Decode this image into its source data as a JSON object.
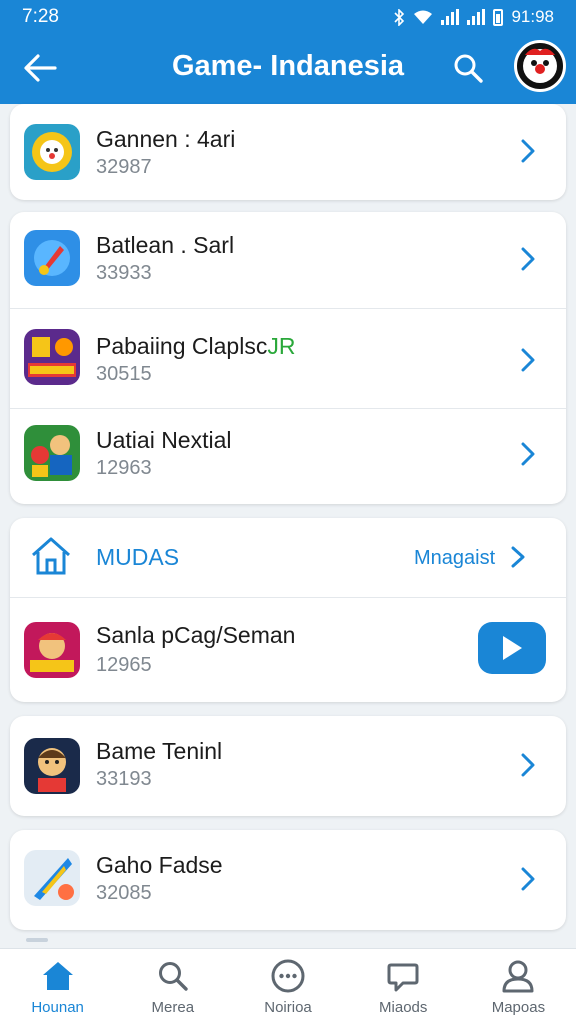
{
  "status_bar": {
    "time": "7:28",
    "right_text": "91:98"
  },
  "header": {
    "title": "Game- Indanesia",
    "back_icon": "arrow-left-icon",
    "search_icon": "search-icon",
    "avatar_icon": "clown-avatar-icon"
  },
  "brand_color": "#1a86d6",
  "cards": [
    {
      "items": [
        {
          "name": "Gannen : 4ari",
          "number": "32987",
          "icon": "sun-face-game-icon"
        }
      ]
    },
    {
      "items": [
        {
          "name": "Batlean . Sarl",
          "number": "33933",
          "icon": "rocket-game-icon"
        },
        {
          "name_main": "Pabaiing Claplsc",
          "name_accent": "JR",
          "number": "30515",
          "icon": "arcade-game-icon"
        },
        {
          "name": "Uatiai Nextial",
          "number": "12963",
          "icon": "hero-game-icon"
        }
      ]
    }
  ],
  "section": {
    "title": "MUDAS",
    "link": "Mnagaist",
    "home_icon": "home-icon",
    "item": {
      "name": "Sanla pCag/Seman",
      "number": "12965",
      "icon": "cartoon-game-icon",
      "action_icon": "play-icon"
    }
  },
  "bottom_cards": [
    {
      "name": "Bame Teninl",
      "number": "33193",
      "icon": "boy-game-icon"
    },
    {
      "name": "Gaho Fadse",
      "number": "32085",
      "icon": "dragon-game-icon"
    }
  ],
  "bottom_nav": [
    {
      "label": "Hounan",
      "icon": "home-icon",
      "active": true
    },
    {
      "label": "Merea",
      "icon": "search-icon",
      "active": false
    },
    {
      "label": "Noirioa",
      "icon": "chat-bubble-icon",
      "active": false
    },
    {
      "label": "Miaods",
      "icon": "speech-bubble-icon",
      "active": false
    },
    {
      "label": "Mapoas",
      "icon": "person-icon",
      "active": false
    }
  ]
}
